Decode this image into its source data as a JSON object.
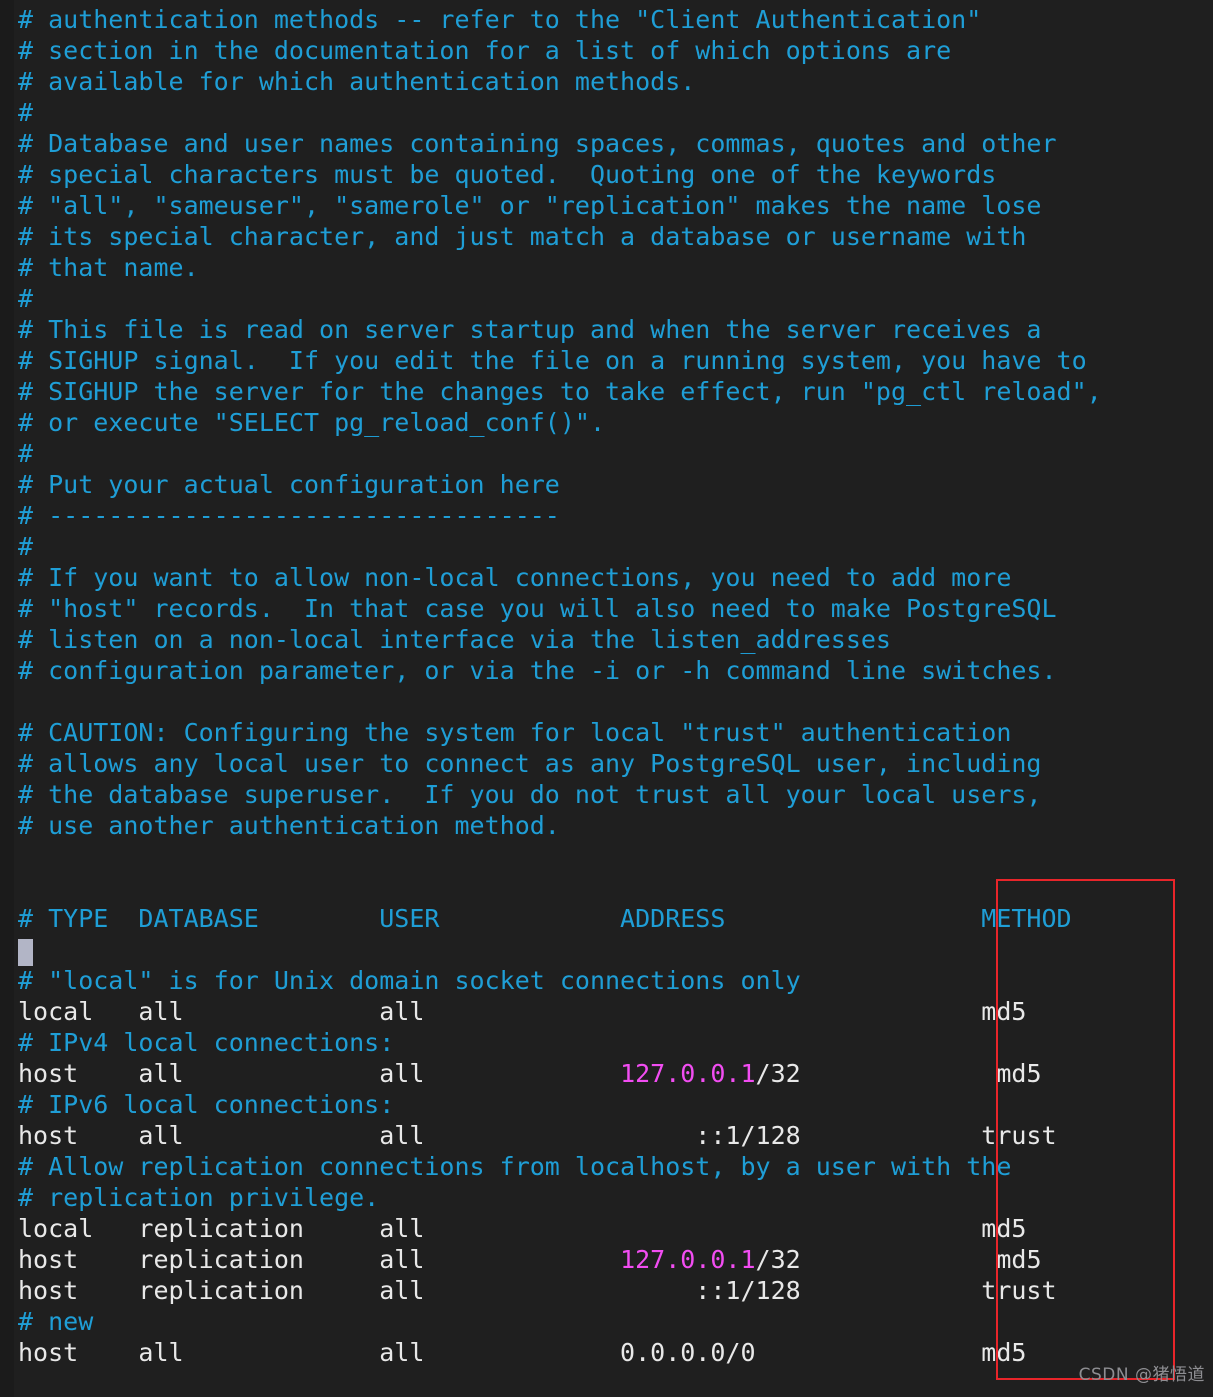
{
  "editor": {
    "file_kind": "pg_hba.conf",
    "background_color": "#1f1f1f",
    "comment_color": "#1f9ed6",
    "text_color": "#e8e8e8",
    "ip_color": "#f24df2",
    "annotation_color": "#e8252a",
    "caret_color": "#b2b5c6"
  },
  "watermark": {
    "text": "CSDN @猪悟道"
  },
  "lines": [
    {
      "id": "l01",
      "segments": [
        {
          "cls": "cm",
          "t": "# authentication methods -- refer to the \"Client Authentication\""
        }
      ]
    },
    {
      "id": "l02",
      "segments": [
        {
          "cls": "cm",
          "t": "# section in the documentation for a list of which options are"
        }
      ]
    },
    {
      "id": "l03",
      "segments": [
        {
          "cls": "cm",
          "t": "# available for which authentication methods."
        }
      ]
    },
    {
      "id": "l04",
      "segments": [
        {
          "cls": "cm",
          "t": "#"
        }
      ]
    },
    {
      "id": "l05",
      "segments": [
        {
          "cls": "cm",
          "t": "# Database and user names containing spaces, commas, quotes and other"
        }
      ]
    },
    {
      "id": "l06",
      "segments": [
        {
          "cls": "cm",
          "t": "# special characters must be quoted.  Quoting one of the keywords"
        }
      ]
    },
    {
      "id": "l07",
      "segments": [
        {
          "cls": "cm",
          "t": "# \"all\", \"sameuser\", \"samerole\" or \"replication\" makes the name lose"
        }
      ]
    },
    {
      "id": "l08",
      "segments": [
        {
          "cls": "cm",
          "t": "# its special character, and just match a database or username with"
        }
      ]
    },
    {
      "id": "l09",
      "segments": [
        {
          "cls": "cm",
          "t": "# that name."
        }
      ]
    },
    {
      "id": "l10",
      "segments": [
        {
          "cls": "cm",
          "t": "#"
        }
      ]
    },
    {
      "id": "l11",
      "segments": [
        {
          "cls": "cm",
          "t": "# This file is read on server startup and when the server receives a"
        }
      ]
    },
    {
      "id": "l12",
      "segments": [
        {
          "cls": "cm",
          "t": "# SIGHUP signal.  If you edit the file on a running system, you have to"
        }
      ]
    },
    {
      "id": "l13",
      "segments": [
        {
          "cls": "cm",
          "t": "# SIGHUP the server for the changes to take effect, run \"pg_ctl reload\","
        }
      ]
    },
    {
      "id": "l14",
      "segments": [
        {
          "cls": "cm",
          "t": "# or execute \"SELECT pg_reload_conf()\"."
        }
      ]
    },
    {
      "id": "l15",
      "segments": [
        {
          "cls": "cm",
          "t": "#"
        }
      ]
    },
    {
      "id": "l16",
      "segments": [
        {
          "cls": "cm",
          "t": "# Put your actual configuration here"
        }
      ]
    },
    {
      "id": "l17",
      "segments": [
        {
          "cls": "cm",
          "t": "# ----------------------------------"
        }
      ]
    },
    {
      "id": "l18",
      "segments": [
        {
          "cls": "cm",
          "t": "#"
        }
      ]
    },
    {
      "id": "l19",
      "segments": [
        {
          "cls": "cm",
          "t": "# If you want to allow non-local connections, you need to add more"
        }
      ]
    },
    {
      "id": "l20",
      "segments": [
        {
          "cls": "cm",
          "t": "# \"host\" records.  In that case you will also need to make PostgreSQL"
        }
      ]
    },
    {
      "id": "l21",
      "segments": [
        {
          "cls": "cm",
          "t": "# listen on a non-local interface via the listen_addresses"
        }
      ]
    },
    {
      "id": "l22",
      "segments": [
        {
          "cls": "cm",
          "t": "# configuration parameter, or via the -i or -h command line switches."
        }
      ]
    },
    {
      "id": "l23",
      "segments": [
        {
          "cls": "cm",
          "t": ""
        }
      ]
    },
    {
      "id": "l24",
      "segments": [
        {
          "cls": "cm",
          "t": "# CAUTION: Configuring the system for local \"trust\" authentication"
        }
      ]
    },
    {
      "id": "l25",
      "segments": [
        {
          "cls": "cm",
          "t": "# allows any local user to connect as any PostgreSQL user, including"
        }
      ]
    },
    {
      "id": "l26",
      "segments": [
        {
          "cls": "cm",
          "t": "# the database superuser.  If you do not trust all your local users,"
        }
      ]
    },
    {
      "id": "l27",
      "segments": [
        {
          "cls": "cm",
          "t": "# use another authentication method."
        }
      ]
    },
    {
      "id": "l28",
      "segments": [
        {
          "cls": "cm",
          "t": ""
        }
      ]
    },
    {
      "id": "l29",
      "segments": [
        {
          "cls": "cm",
          "t": ""
        }
      ]
    },
    {
      "id": "l30",
      "segments": [
        {
          "cls": "cm",
          "t": "# TYPE  DATABASE        USER            ADDRESS                 METHOD"
        }
      ]
    },
    {
      "id": "l31",
      "segments": [
        {
          "cls": "tx",
          "t": ""
        }
      ]
    },
    {
      "id": "l32",
      "segments": [
        {
          "cls": "cm",
          "t": "# \"local\" is for Unix domain socket connections only"
        }
      ]
    },
    {
      "id": "l33",
      "segments": [
        {
          "cls": "tx",
          "t": "local   all             all                                     md5"
        }
      ]
    },
    {
      "id": "l34",
      "segments": [
        {
          "cls": "cm",
          "t": "# IPv4 local connections:"
        }
      ]
    },
    {
      "id": "l35",
      "segments": [
        {
          "cls": "tx",
          "t": "host    all             all             "
        },
        {
          "cls": "ip",
          "t": "127.0.0.1"
        },
        {
          "cls": "tx",
          "t": "/32             md5"
        }
      ]
    },
    {
      "id": "l36",
      "segments": [
        {
          "cls": "cm",
          "t": "# IPv6 local connections:"
        }
      ]
    },
    {
      "id": "l37",
      "segments": [
        {
          "cls": "tx",
          "t": "host    all             all                  ::1/128            trust"
        }
      ]
    },
    {
      "id": "l38",
      "segments": [
        {
          "cls": "cm",
          "t": "# Allow replication connections from localhost, by a user with the"
        }
      ]
    },
    {
      "id": "l39",
      "segments": [
        {
          "cls": "cm",
          "t": "# replication privilege."
        }
      ]
    },
    {
      "id": "l40",
      "segments": [
        {
          "cls": "tx",
          "t": "local   replication     all                                     md5"
        }
      ]
    },
    {
      "id": "l41",
      "segments": [
        {
          "cls": "tx",
          "t": "host    replication     all             "
        },
        {
          "cls": "ip",
          "t": "127.0.0.1"
        },
        {
          "cls": "tx",
          "t": "/32             md5"
        }
      ]
    },
    {
      "id": "l42",
      "segments": [
        {
          "cls": "tx",
          "t": "host    replication     all                  ::1/128            trust"
        }
      ]
    },
    {
      "id": "l43",
      "segments": [
        {
          "cls": "cm",
          "t": "# new"
        }
      ]
    },
    {
      "id": "l44",
      "segments": [
        {
          "cls": "tx",
          "t": "host    all             all             0.0.0.0/0               md5"
        }
      ]
    }
  ],
  "hba_table": {
    "headers": [
      "# TYPE",
      "DATABASE",
      "USER",
      "ADDRESS",
      "METHOD"
    ],
    "rows": [
      {
        "type": "local",
        "database": "all",
        "user": "all",
        "address": "",
        "method": "md5"
      },
      {
        "type": "host",
        "database": "all",
        "user": "all",
        "address": "127.0.0.1/32",
        "method": "md5"
      },
      {
        "type": "host",
        "database": "all",
        "user": "all",
        "address": "::1/128",
        "method": "trust"
      },
      {
        "type": "local",
        "database": "replication",
        "user": "all",
        "address": "",
        "method": "md5"
      },
      {
        "type": "host",
        "database": "replication",
        "user": "all",
        "address": "127.0.0.1/32",
        "method": "md5"
      },
      {
        "type": "host",
        "database": "replication",
        "user": "all",
        "address": "::1/128",
        "method": "trust"
      },
      {
        "type": "host",
        "database": "all",
        "user": "all",
        "address": "0.0.0.0/0",
        "method": "md5"
      }
    ]
  },
  "annotation": {
    "label": "method-column-highlight",
    "color": "#e8252a"
  }
}
